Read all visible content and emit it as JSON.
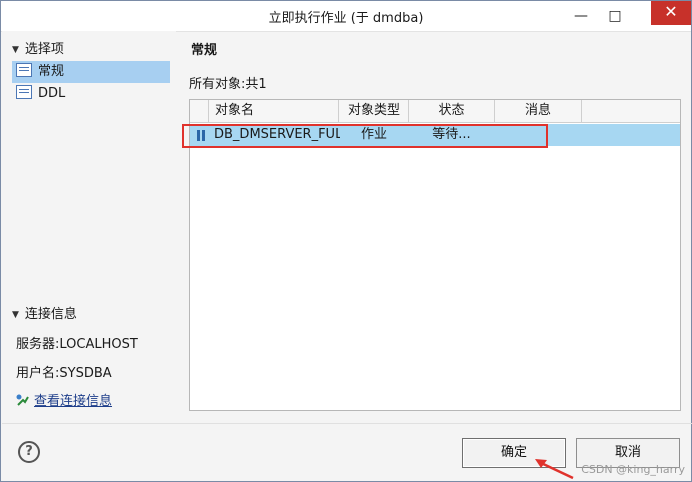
{
  "window": {
    "title": "立即执行作业 (于 dmdba)",
    "min_glyph": "—",
    "max_glyph": "□",
    "close_glyph": "✕"
  },
  "left": {
    "options_header": "选择项",
    "items": [
      {
        "label": "常规",
        "selected": true
      },
      {
        "label": "DDL",
        "selected": false
      }
    ],
    "connection_header": "连接信息",
    "server": "服务器:LOCALHOST",
    "user": "用户名:SYSDBA",
    "view_link": "查看连接信息"
  },
  "main": {
    "section_title": "常规",
    "count_label": "所有对象:共1",
    "columns": [
      "对象名",
      "对象类型",
      "状态",
      "消息"
    ],
    "rows": [
      {
        "name": "DB_DMSERVER_FUL",
        "type": "作业",
        "status": "等待...",
        "message": ""
      }
    ],
    "row_icon": "pause-icon"
  },
  "footer": {
    "help_glyph": "?",
    "ok_label": "确定",
    "cancel_label": "取消"
  },
  "watermark": "CSDN @king_harry",
  "colors": {
    "selection": "#a7cff1",
    "row_highlight": "#a7d7f2",
    "annotation_red": "#e0322c"
  }
}
